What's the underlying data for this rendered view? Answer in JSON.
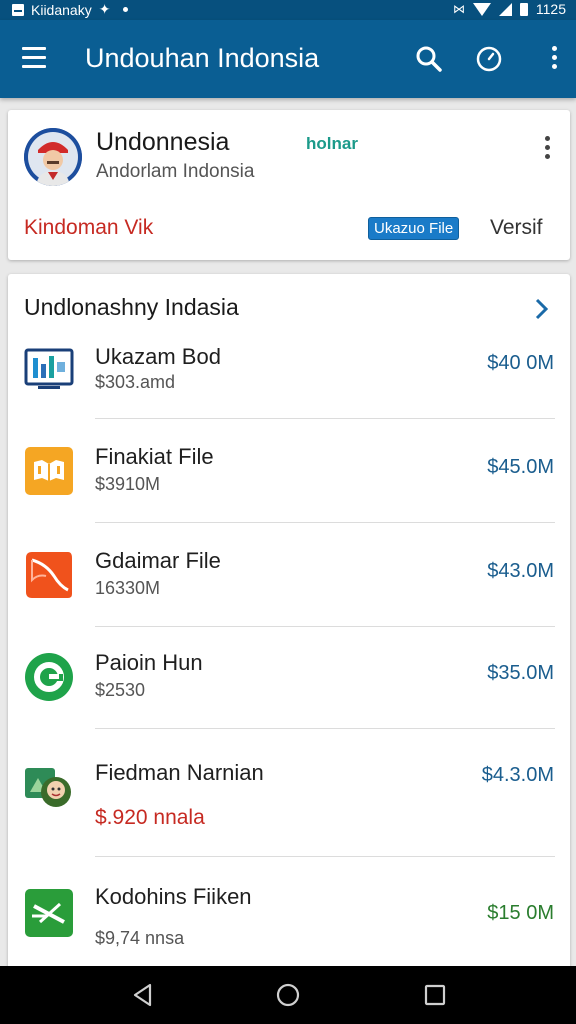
{
  "status": {
    "left_text": "Kiidanaky",
    "time": "1125"
  },
  "appbar": {
    "title": "Undouhan Indonsia"
  },
  "top_card": {
    "name": "Undonnesia",
    "subtitle": "Andorlam Indonsia",
    "tag": "holnar",
    "link": "Kindoman Vik",
    "badge": "Ukazuo File",
    "versi": "Versif"
  },
  "list": {
    "header": "Undlonashny Indasia",
    "items": [
      {
        "title": "Ukazam Bod",
        "subtitle": "$303.amd",
        "amount": "$40 0M",
        "icon": "dashboard-icon",
        "amount_color": "#1a5d8e",
        "subtitle_color": "#555555"
      },
      {
        "title": "Finakiat File",
        "subtitle": "$3910M",
        "amount": "$45.0M",
        "icon": "book-icon",
        "amount_color": "#444444",
        "subtitle_color": "#555555"
      },
      {
        "title": "Gdaimar File",
        "subtitle": "16330M",
        "amount": "$43.0M",
        "icon": "document-icon",
        "amount_color": "#1a5d8e",
        "subtitle_color": "#555555"
      },
      {
        "title": "Paioin Hun",
        "subtitle": "$2530",
        "amount": "$35.0M",
        "icon": "refresh-icon",
        "amount_color": "#1a5d8e",
        "subtitle_color": "#555555"
      },
      {
        "title": "Fiedman Narnian",
        "subtitle": "$.920 nnala",
        "amount": "$4.3.0M",
        "icon": "people-icon",
        "amount_color": "#1a5d8e",
        "subtitle_color": "#c62a22"
      },
      {
        "title": "Kodohins Fiiken",
        "subtitle": "$9,74 nnsa",
        "amount": "$15 0M",
        "icon": "tools-icon",
        "amount_color": "#2a7d2e",
        "subtitle_color": "#555555"
      }
    ]
  },
  "colors": {
    "appbar": "#0a5e93",
    "accent": "#1a7bc8",
    "red": "#c62a22",
    "green": "#2a7d2e"
  }
}
